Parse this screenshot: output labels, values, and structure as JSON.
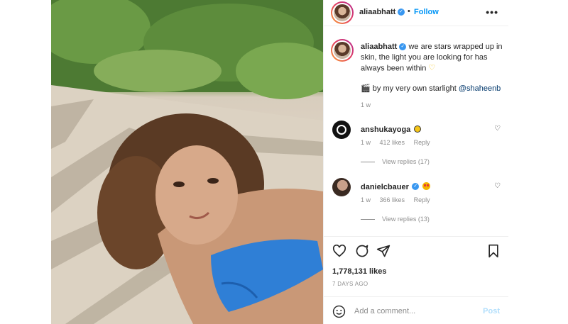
{
  "post": {
    "username": "aliaabhatt",
    "follow_label": "Follow",
    "separator": "•",
    "more_label": "•••"
  },
  "caption": {
    "username": "aliaabhatt",
    "text": "we are stars wrapped up in skin, the light you are looking for has always been within",
    "emoji_end": "♡",
    "credit_icon": "🎬",
    "credit_text": "by my very own starlight",
    "mention": "@shaheenb",
    "time": "1 w"
  },
  "comments": [
    {
      "username": "anshukayoga",
      "emoji": "sun",
      "time": "1 w",
      "likes": "412 likes",
      "reply_label": "Reply",
      "view_replies": "View replies (17)"
    },
    {
      "username": "danielcbauer",
      "emoji": "star-struck",
      "time": "1 w",
      "likes": "366 likes",
      "reply_label": "Reply",
      "view_replies": "View replies (13)"
    }
  ],
  "engagement": {
    "likes": "1,778,131 likes",
    "date": "7 DAYS AGO"
  },
  "comment_box": {
    "placeholder": "Add a comment...",
    "post_label": "Post"
  },
  "icons": {
    "like": "heart-icon",
    "comment": "comment-icon",
    "share": "share-icon",
    "save": "bookmark-icon",
    "emoji": "emoji-icon",
    "verified": "verified-badge-icon"
  },
  "colors": {
    "accent": "#0095f6",
    "verified": "#3897f0",
    "muted": "#8e8e8e",
    "post_disabled": "#b2dffc"
  }
}
